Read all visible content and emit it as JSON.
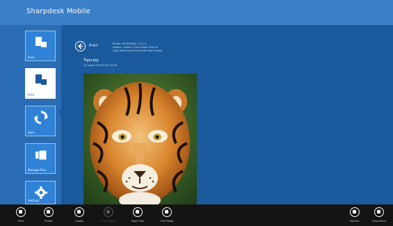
{
  "app": {
    "title": "Sharpdesk Mobile"
  },
  "sidebar": {
    "items": [
      {
        "label": "Scan",
        "icon": "scan-icon"
      },
      {
        "label": "Print",
        "icon": "print-icon"
      },
      {
        "label": "Sync",
        "icon": "sync-icon"
      },
      {
        "label": "Manage Files",
        "icon": "manage-files-icon"
      },
      {
        "label": "Settings",
        "icon": "gear-icon"
      }
    ]
  },
  "print": {
    "back_label": "Print",
    "settings": [
      "Printer: JX-9000ABC 2.3.4.5",
      "Duplex: Copies 1 Color Paper Size A4",
      "Color Mode Auto Print Mode High Quality"
    ],
    "document_name": "Tiger.jpg",
    "document_meta": "1/1 page 2013/07/15 10:45"
  },
  "appbar": {
    "buttons": [
      {
        "label": "Print",
        "icon": "print-icon",
        "enabled": true
      },
      {
        "label": "Printer",
        "icon": "printer-icon",
        "enabled": true
      },
      {
        "label": "Copies",
        "icon": "copies-icon",
        "enabled": true
      },
      {
        "label": "Color Mode",
        "icon": "color-mode-icon",
        "enabled": false
      },
      {
        "label": "Paper Size",
        "icon": "paper-size-icon",
        "enabled": true
      },
      {
        "label": "Print Mode",
        "icon": "print-mode-icon",
        "enabled": true
      },
      {
        "label": "Refresh",
        "icon": "refresh-icon",
        "enabled": true
      },
      {
        "label": "Close Menu",
        "icon": "close-menu-icon",
        "enabled": true
      }
    ]
  },
  "colors": {
    "accent": "#3a7fc8",
    "background": "#1b5a9c",
    "sidebar": "#2a6db4",
    "appbar": "#141414"
  }
}
